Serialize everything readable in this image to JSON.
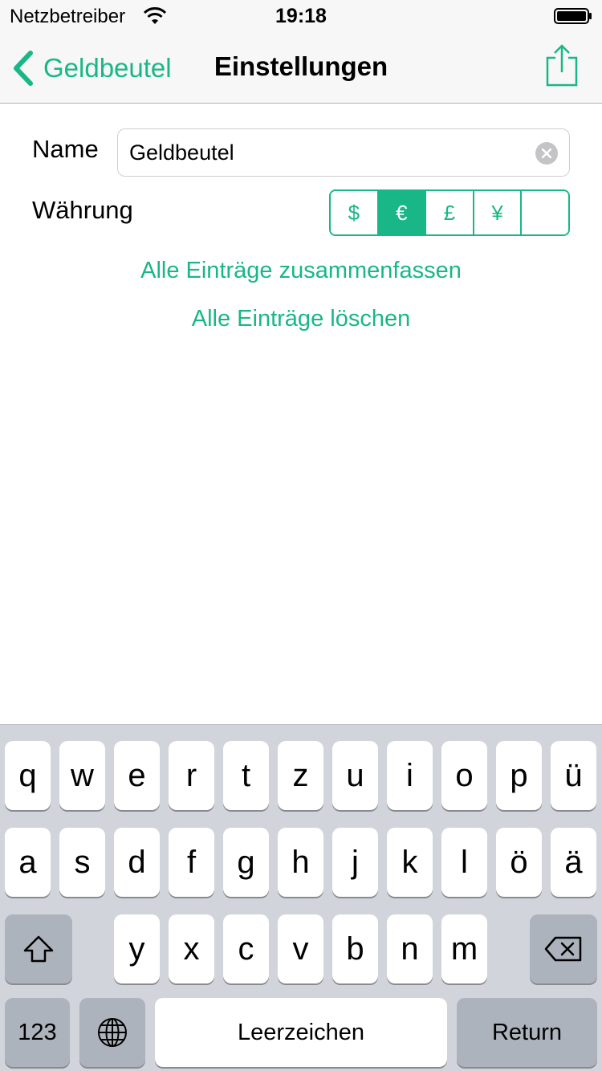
{
  "status_bar": {
    "carrier": "Netzbetreiber",
    "time": "19:18"
  },
  "nav": {
    "back_label": "Geldbeutel",
    "title": "Einstellungen"
  },
  "form": {
    "name_label": "Name",
    "name_value": "Geldbeutel",
    "currency_label": "Währung",
    "currencies": [
      "$",
      "€",
      "£",
      "¥",
      ""
    ],
    "selected_currency": "€"
  },
  "actions": {
    "merge_all": "Alle Einträge zusammenfassen",
    "delete_all": "Alle Einträge löschen"
  },
  "keyboard": {
    "row1": [
      "q",
      "w",
      "e",
      "r",
      "t",
      "z",
      "u",
      "i",
      "o",
      "p",
      "ü"
    ],
    "row2": [
      "a",
      "s",
      "d",
      "f",
      "g",
      "h",
      "j",
      "k",
      "l",
      "ö",
      "ä"
    ],
    "row3": [
      "y",
      "x",
      "c",
      "v",
      "b",
      "n",
      "m"
    ],
    "numbers_key": "123",
    "space_key": "Leerzeichen",
    "return_key": "Return"
  },
  "colors": {
    "accent": "#19b787",
    "keyboard_bg": "#d1d5db",
    "dark_key": "#adb3bc"
  }
}
